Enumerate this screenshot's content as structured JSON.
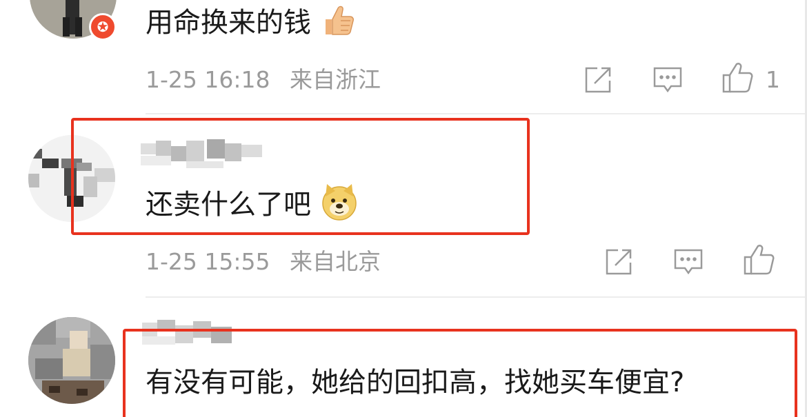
{
  "comments": [
    {
      "text": "用命换来的钱",
      "emoji": "thumbs-up-emoji",
      "time": "1-25 16:18",
      "location": "来自浙江",
      "like_count": "1",
      "verified": true
    },
    {
      "text": "还卖什么了吧",
      "emoji": "doge-emoji",
      "time": "1-25 15:55",
      "location": "来自北京",
      "like_count": ""
    },
    {
      "text": "有没有可能，她给的回扣高，找她买车便宜?"
    }
  ],
  "colors": {
    "highlight": "#e8321e",
    "meta_text": "#9a9a9a",
    "body_text": "#1a1a1a",
    "badge": "#ef4a2e"
  },
  "icons": [
    "share-icon",
    "reply-icon",
    "like-icon"
  ]
}
